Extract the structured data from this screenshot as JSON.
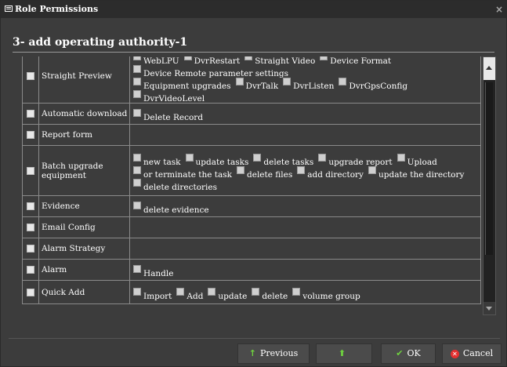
{
  "window": {
    "title": "Role Permissions",
    "close_glyph": "×"
  },
  "header": {
    "subtitle": "3- add operating authority-1"
  },
  "rows": [
    {
      "name": "Straight Preview",
      "perms": [
        [
          "WebLPU",
          "DvrRestart",
          "Straight Video",
          "Device Format",
          "Device Remote parameter settings"
        ],
        [
          "Equipment upgrades",
          "DvrTalk",
          "DvrListen",
          "DvrGpsConfig",
          "DvrVideoLevel"
        ]
      ]
    },
    {
      "name": "Automatic download",
      "perms": [
        [
          "Delete Record"
        ]
      ]
    },
    {
      "name": "Report form",
      "perms": []
    },
    {
      "name": "Batch upgrade equipment",
      "perms": [
        [
          "new task",
          "update tasks",
          "delete tasks",
          "upgrade report",
          "Upload"
        ],
        [
          "or terminate the task",
          "delete files",
          "add directory",
          "update the directory",
          "delete directories"
        ]
      ]
    },
    {
      "name": "Evidence",
      "perms": [
        [
          "delete evidence"
        ]
      ]
    },
    {
      "name": "Email Config",
      "perms": []
    },
    {
      "name": "Alarm Strategy",
      "perms": []
    },
    {
      "name": "Alarm",
      "perms": [
        [
          "Handle"
        ]
      ]
    },
    {
      "name": "Quick Add",
      "perms": [
        [
          "Import",
          "Add",
          "update",
          "delete",
          "volume group"
        ]
      ]
    }
  ],
  "footer": {
    "previous_label": "Previous",
    "next_label": "",
    "ok_label": "OK",
    "cancel_label": "Cancel",
    "prev_icon": "↑",
    "next_icon": "⬆",
    "ok_icon": "✔",
    "cancel_icon": "✕"
  }
}
